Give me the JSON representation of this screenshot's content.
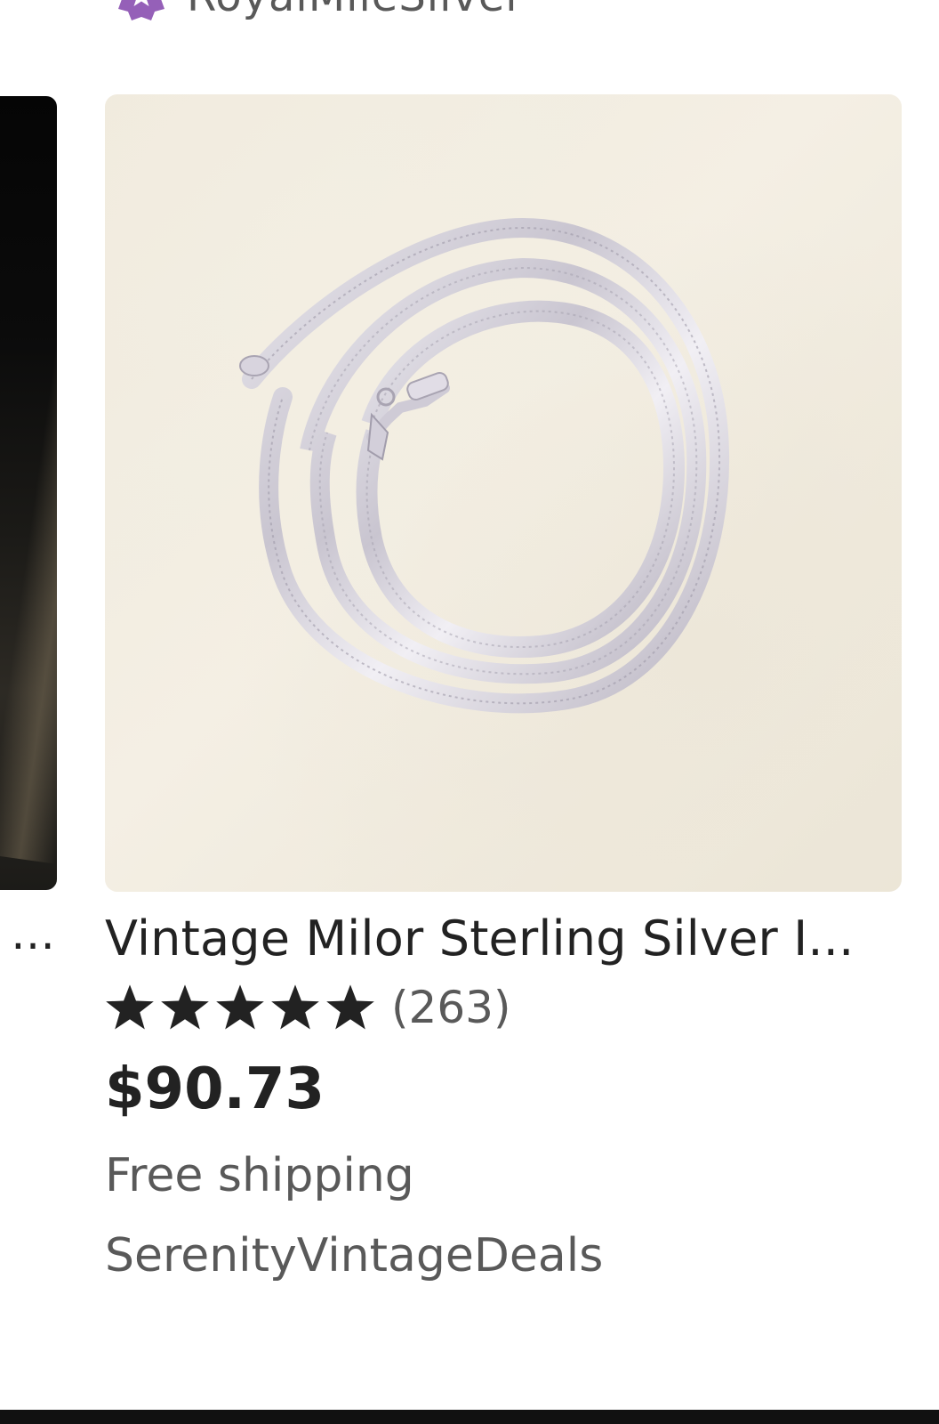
{
  "top_seller": {
    "name": "RoyalMileSilver",
    "badge_icon": "star-badge-icon",
    "badge_color": "#9560b8"
  },
  "left_listing": {
    "title_fragment": "…"
  },
  "listing": {
    "image_alt": "Silver herringbone chain coiled on cream background",
    "title": "Vintage Milor Sterling Silver I...",
    "rating": 5,
    "rating_max": 5,
    "review_count": "(263)",
    "price": "$90.73",
    "shipping": "Free shipping",
    "shop_name": "SerenityVintageDeals"
  },
  "colors": {
    "text_primary": "#222222",
    "text_secondary": "#595959",
    "star": "#222222"
  }
}
